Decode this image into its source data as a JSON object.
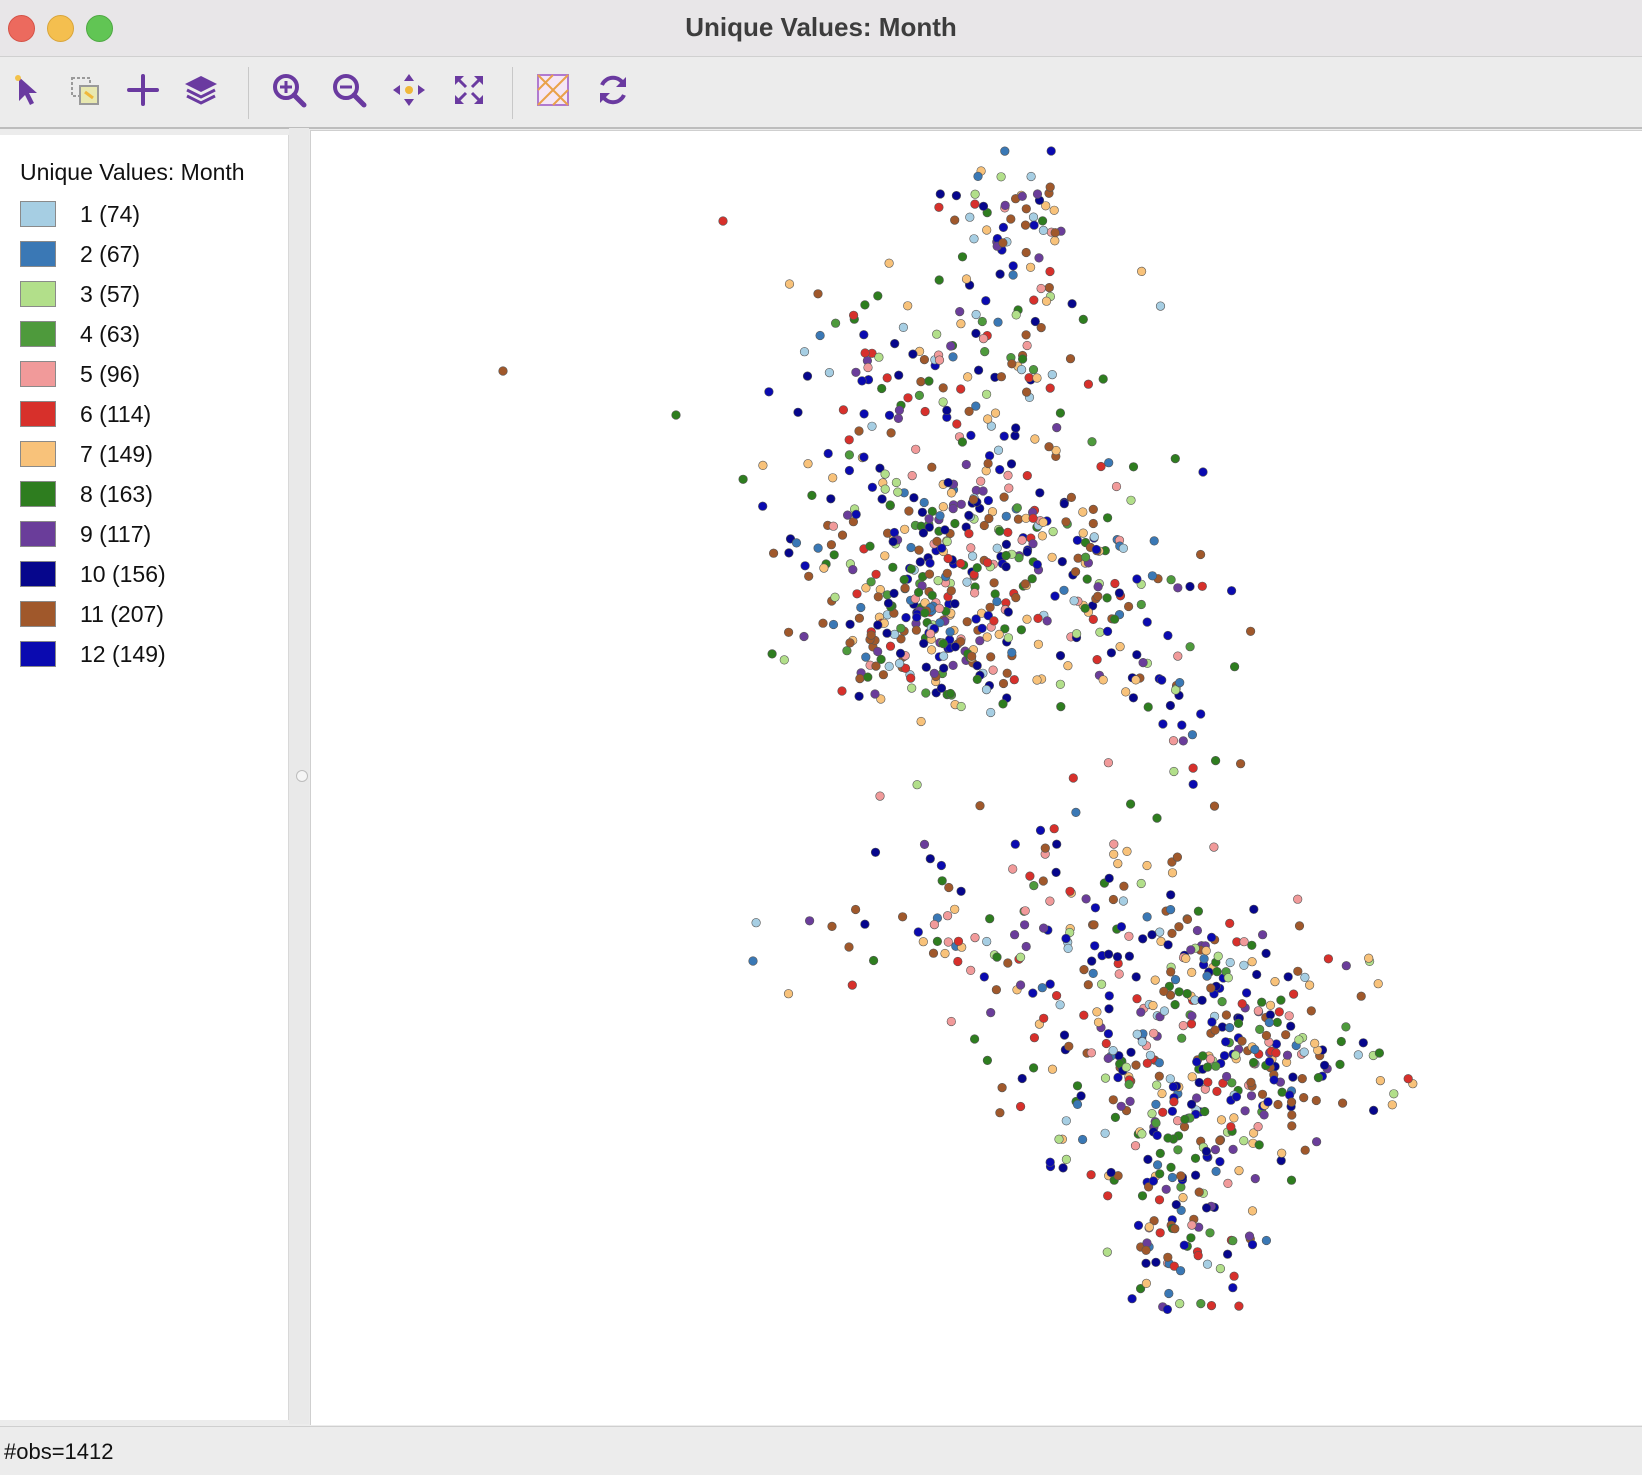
{
  "window": {
    "title": "Unique Values: Month"
  },
  "toolbar": {
    "buttons": [
      {
        "name": "select-tool-button",
        "icon": "pointer-arrow-icon"
      },
      {
        "name": "selection-shape-button",
        "icon": "selection-shape-icon"
      },
      {
        "name": "add-layer-button",
        "icon": "plus-icon"
      },
      {
        "name": "layers-button",
        "icon": "layers-icon"
      },
      {
        "name": "zoom-in-button",
        "icon": "zoom-in-icon"
      },
      {
        "name": "zoom-out-button",
        "icon": "zoom-out-icon"
      },
      {
        "name": "pan-button",
        "icon": "pan-arrows-icon"
      },
      {
        "name": "full-extent-button",
        "icon": "expand-icon"
      },
      {
        "name": "basemap-button",
        "icon": "basemap-icon"
      },
      {
        "name": "refresh-button",
        "icon": "refresh-icon"
      }
    ],
    "icon_color": "#6a3aa0"
  },
  "legend": {
    "title": "Unique Values: Month",
    "items": [
      {
        "label": "1 (74)",
        "color": "#a6cee3"
      },
      {
        "label": "2 (67)",
        "color": "#3a78b5"
      },
      {
        "label": "3 (57)",
        "color": "#b2df8a"
      },
      {
        "label": "4 (63)",
        "color": "#4e9a3c"
      },
      {
        "label": "5 (96)",
        "color": "#f19a9a"
      },
      {
        "label": "6 (114)",
        "color": "#d7302b"
      },
      {
        "label": "7 (149)",
        "color": "#f8c27a"
      },
      {
        "label": "8 (163)",
        "color": "#2e7d1f"
      },
      {
        "label": "9 (117)",
        "color": "#6a3d9a"
      },
      {
        "label": "10 (156)",
        "color": "#06068c"
      },
      {
        "label": "11 (207)",
        "color": "#a0582b"
      },
      {
        "label": "12 (149)",
        "color": "#0a0ab0"
      }
    ]
  },
  "status": {
    "text": "#obs=1412"
  }
}
